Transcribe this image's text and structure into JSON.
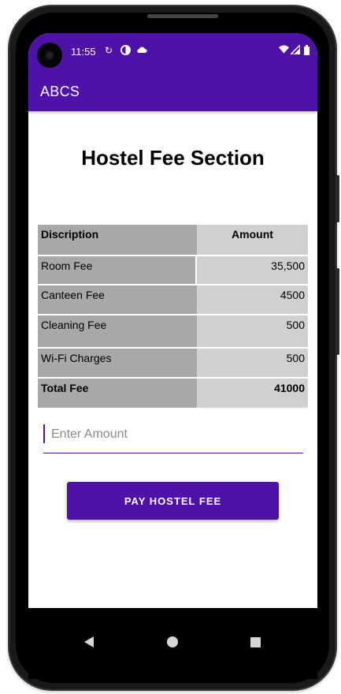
{
  "status_bar": {
    "time": "11:55"
  },
  "app_bar": {
    "title": "ABCS",
    "color": "#4f12a8"
  },
  "page": {
    "heading": "Hostel Fee Section"
  },
  "fee_table": {
    "headers": [
      "Discription",
      "Amount"
    ],
    "rows": [
      {
        "description": "Room Fee",
        "amount": "35,500"
      },
      {
        "description": "Canteen Fee",
        "amount": "4500"
      },
      {
        "description": "Cleaning Fee",
        "amount": "500"
      },
      {
        "description": "Wi-Fi Charges",
        "amount": "500"
      }
    ],
    "total": {
      "description": "Total Fee",
      "amount": "41000"
    }
  },
  "amount_input": {
    "placeholder": "Enter Amount",
    "value": ""
  },
  "pay_button": {
    "label": "PAY HOSTEL FEE"
  },
  "icons": {
    "status_left": [
      "sync-icon",
      "data-saver-icon",
      "cloud-icon"
    ],
    "status_right": [
      "wifi-icon",
      "signal-icon",
      "battery-icon"
    ],
    "nav": [
      "back-icon",
      "home-icon",
      "recents-icon"
    ]
  }
}
